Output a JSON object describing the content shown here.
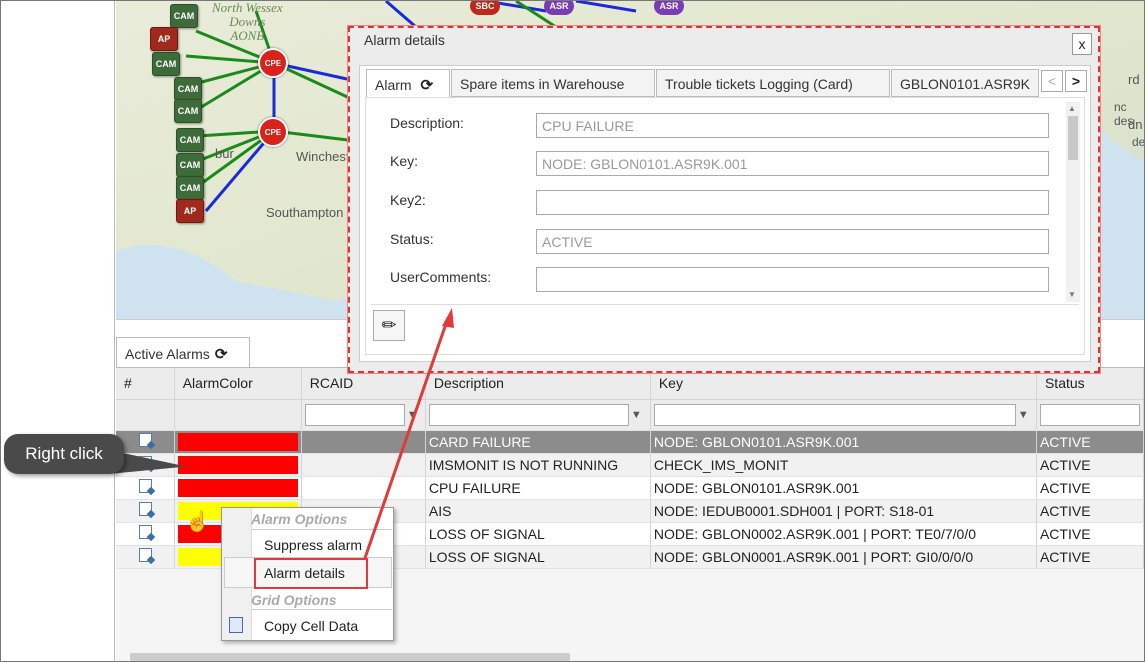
{
  "map": {
    "region_labels": [
      "North Wessex\nDowns\nAONB"
    ],
    "towns": [
      "Winchest",
      "Southampton",
      "bur"
    ],
    "right_text": [
      "rd",
      "dn",
      "nc des",
      "de"
    ],
    "nodes": {
      "cam": "CAM",
      "ap": "AP",
      "cpe": "CPE",
      "sbc": "SBC",
      "asr": "ASR"
    }
  },
  "dialog": {
    "title": "Alarm details",
    "close": "x",
    "tabs": [
      "Alarm",
      "Spare items in Warehouse",
      "Trouble tickets Logging (Card)",
      "GBLON0101.ASR9K"
    ],
    "nav_prev": "<",
    "nav_next": ">",
    "fields": [
      {
        "label": "Description:",
        "value": "CPU FAILURE"
      },
      {
        "label": "Key:",
        "value": "NODE: GBLON0101.ASR9K.001"
      },
      {
        "label": "Key2:",
        "value": ""
      },
      {
        "label": "Status:",
        "value": "ACTIVE"
      },
      {
        "label": "UserComments:",
        "value": ""
      }
    ]
  },
  "active_alarms": {
    "tab_label": "Active Alarms",
    "columns": [
      "#",
      "AlarmColor",
      "RCAID",
      "Description",
      "Key",
      "Status"
    ],
    "rows": [
      {
        "color": "#ff0000",
        "rcaid": "",
        "description": "CARD FAILURE",
        "key": "NODE: GBLON0101.ASR9K.001",
        "status": "ACTIVE",
        "selected": true
      },
      {
        "color": "#ff0000",
        "rcaid": "",
        "description": "IMSMONIT IS NOT RUNNING",
        "key": "CHECK_IMS_MONIT",
        "status": "ACTIVE"
      },
      {
        "color": "#ff0000",
        "rcaid": "",
        "description": "CPU FAILURE",
        "key": "NODE: GBLON0101.ASR9K.001",
        "status": "ACTIVE"
      },
      {
        "color": "#ffff00",
        "rcaid": "",
        "description": "AIS",
        "key": "NODE: IEDUB0001.SDH001 | PORT: S18-01",
        "status": "ACTIVE"
      },
      {
        "color": "#ff0000",
        "rcaid": "",
        "description": "LOSS OF SIGNAL",
        "key": "NODE: GBLON0002.ASR9K.001 | PORT: TE0/7/0/0",
        "status": "ACTIVE"
      },
      {
        "color": "#ffff00",
        "rcaid": "",
        "description": "LOSS OF SIGNAL",
        "key": "NODE: GBLON0001.ASR9K.001 | PORT: GI0/0/0/0",
        "status": "ACTIVE"
      }
    ]
  },
  "context_menu": {
    "alarm_options_header": "Alarm Options",
    "suppress": "Suppress alarm",
    "details": "Alarm details",
    "grid_options_header": "Grid Options",
    "copy": "Copy Cell Data"
  },
  "callout": {
    "text": "Right click"
  },
  "colors": {
    "highlight_red": "#e03a3a",
    "selected_row": "#8c8c8c"
  }
}
